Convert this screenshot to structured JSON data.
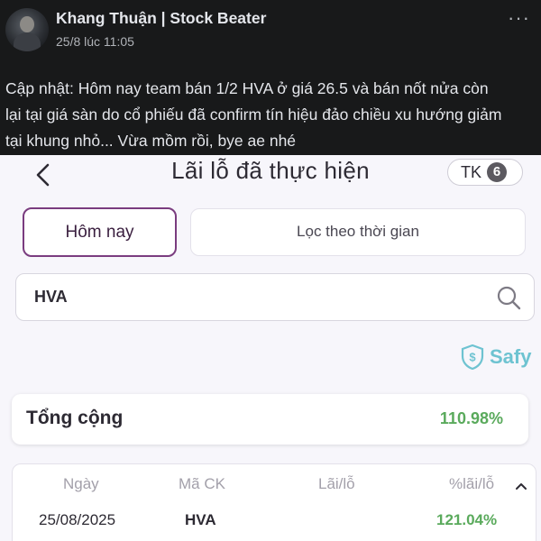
{
  "post": {
    "author": "Khang Thuận | Stock Beater",
    "timestamp": "25/8 lúc 11:05",
    "more_label": "···",
    "text": "Cập nhật: Hôm nay team bán 1/2 HVA ở giá 26.5 và bán nốt nửa còn\nlại tại giá sàn do cổ phiếu đã confirm tín hiệu đảo chiều xu hướng giảm\ntại khung nhỏ... Vừa mồm rồi, bye ae nhé"
  },
  "app": {
    "title": "Lãi lỗ đã thực hiện",
    "account_label": "TK",
    "account_badge": "6",
    "tabs": {
      "today": "Hôm nay",
      "filter": "Lọc theo thời gian"
    },
    "search": {
      "value": "HVA"
    },
    "brand": "Safy",
    "total": {
      "label": "Tổng cộng",
      "value": "110.98%"
    },
    "table": {
      "headers": [
        "Ngày",
        "Mã CK",
        "Lãi/lỗ",
        "%lãi/lỗ"
      ],
      "rows": [
        {
          "date": "25/08/2025",
          "ticker": "HVA",
          "pnl": "",
          "pnl_pct": "121.04%"
        }
      ]
    },
    "colors": {
      "accent": "#7a3c7f",
      "positive": "#5aaa5c",
      "brand": "#6ec3d1"
    }
  }
}
